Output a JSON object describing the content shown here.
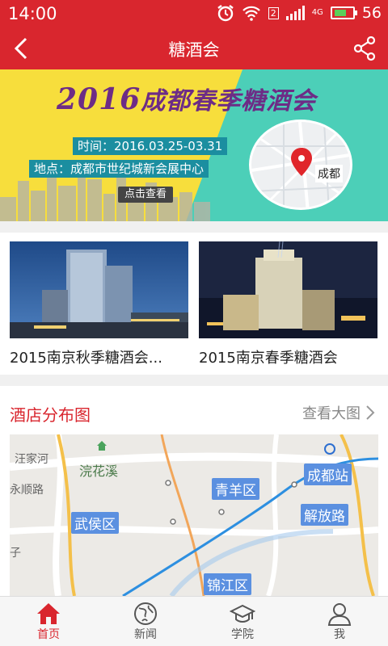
{
  "status_bar": {
    "time": "14:00",
    "battery": "56",
    "network": "4G"
  },
  "header": {
    "title": "糖酒会"
  },
  "banner": {
    "year": "2016",
    "headline": "成都春季糖酒会",
    "time_label": "时间：2016.03.25-03.31",
    "place_label": "地点：成都市世纪城新会展中心",
    "click_label": "点击查看",
    "map_city": "成都"
  },
  "events": [
    {
      "caption": "2015南京秋季糖酒会..."
    },
    {
      "caption": "2015南京春季糖酒会"
    }
  ],
  "hotel_map": {
    "title": "酒店分布图",
    "more_label": "查看大图",
    "labels": {
      "qingyang": "青羊区",
      "wuhou": "武侯区",
      "jinjiang": "锦江区",
      "jiefang": "解放路",
      "chengdu_station": "成都站",
      "huanhuaxi": "浣花溪",
      "wangjiahe": "汪家河",
      "shunlu": "永顺路",
      "zi": "子"
    }
  },
  "bottom_nav": [
    {
      "label": "首页",
      "icon": "home-icon",
      "active": true
    },
    {
      "label": "新闻",
      "icon": "globe-icon",
      "active": false
    },
    {
      "label": "学院",
      "icon": "graduation-cap-icon",
      "active": false
    },
    {
      "label": "我",
      "icon": "person-icon",
      "active": false
    }
  ],
  "colors": {
    "brand_red": "#d9262e",
    "banner_yellow": "#f7de3c",
    "banner_teal": "#4ccfb8",
    "map_label_blue": "#5b90e0"
  }
}
